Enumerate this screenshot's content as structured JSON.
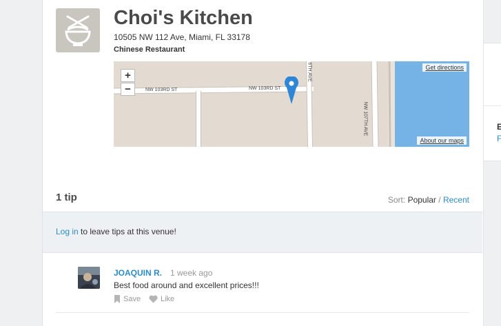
{
  "venue": {
    "name": "Choi's Kitchen",
    "address": "10505 NW 112 Ave, Miami, FL 33178",
    "category": "Chinese Restaurant",
    "icon": "rice-bowl-chopsticks-icon"
  },
  "map": {
    "zoom_in": "+",
    "zoom_out": "−",
    "get_directions": "Get directions",
    "about_maps": "About our maps",
    "street_1": "NW 103RD ST",
    "street_2": "NW 103RD ST",
    "street_3": "NW 107TH AVE",
    "street_4": "6TH AVE"
  },
  "tips": {
    "count_label": "1 tip",
    "sort_label": "Sort:",
    "sort_popular": "Popular",
    "sort_sep": "/",
    "sort_recent": "Recent"
  },
  "login": {
    "link": "Log in",
    "text": " to leave tips at this venue!"
  },
  "tip_list": [
    {
      "user": "JOAQUIN R.",
      "time": "1 week ago",
      "text": "Best food around and excellent prices!!!",
      "save_label": "Save",
      "like_label": "Like"
    }
  ],
  "sidebar": {
    "partial_b": "E",
    "partial_f": "F"
  },
  "colors": {
    "link": "#2d8cc6",
    "map_water": "#75b2e5",
    "map_land": "#e3dbd1",
    "marker": "#2f86d6"
  }
}
